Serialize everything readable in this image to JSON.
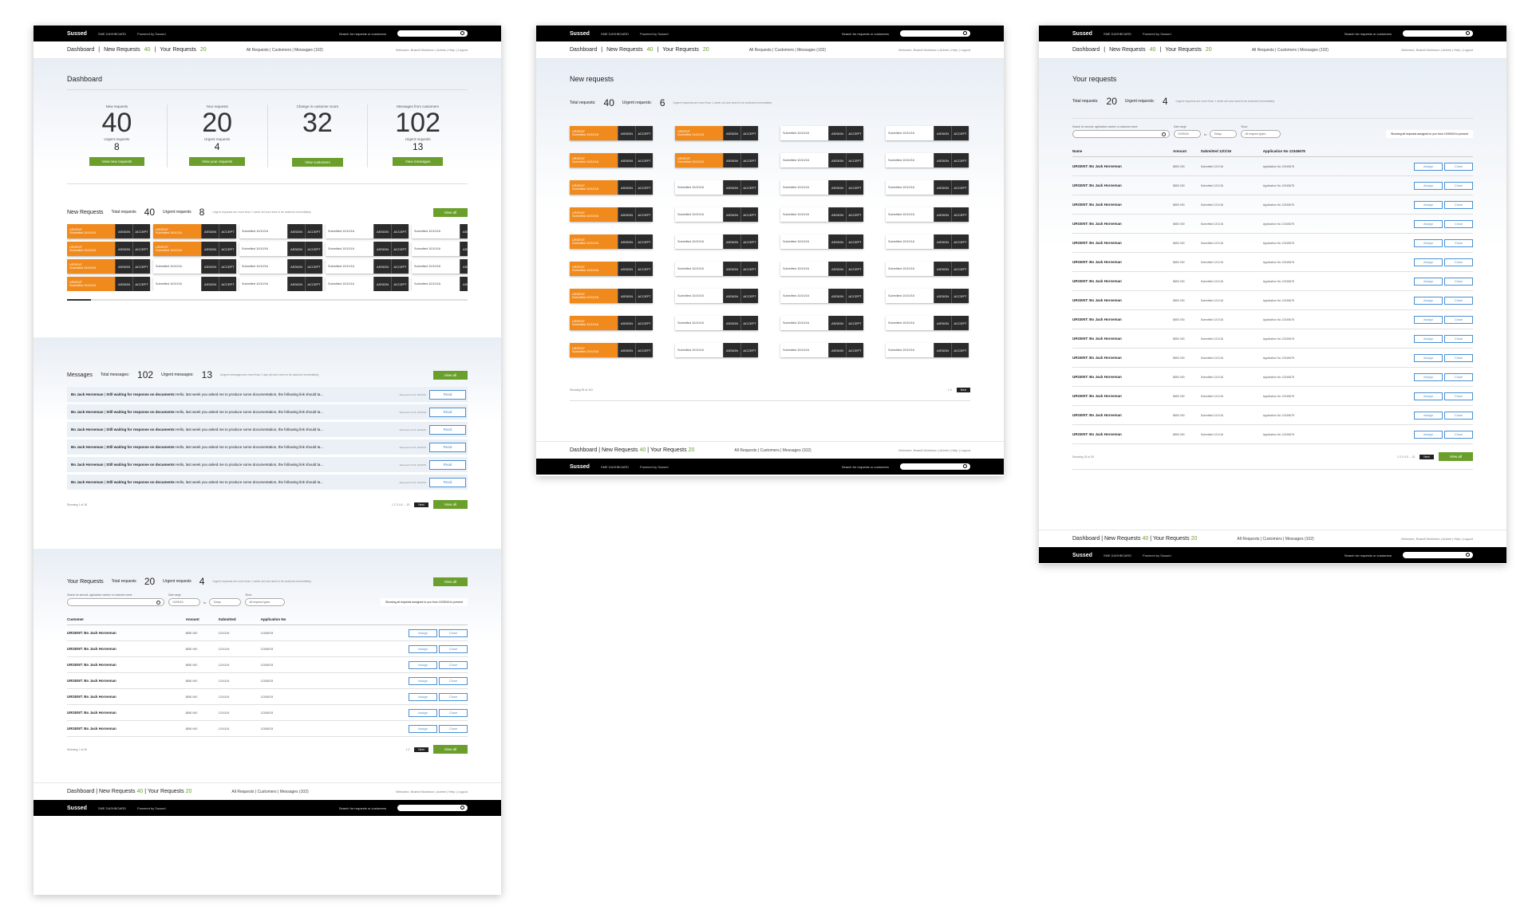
{
  "brand": "Sussed",
  "dashboard_label": "SME DASHBOARD",
  "powered": "Powered by Sussed",
  "search_label": "Search for requests or customers",
  "nav": {
    "dashboard": "Dashboard",
    "new_requests": "New Requests",
    "new_count": "40",
    "your_requests": "Your Requests",
    "your_count": "20",
    "mid": "All Requests | Customers | Messages (102)",
    "right": "Welcome, Brandi Mckinnon | Admin | Help | Logout"
  },
  "page1": {
    "title": "Dashboard",
    "stats": [
      {
        "label": "New requests",
        "big": "40",
        "sub_label": "Urgent requests",
        "sub": "8",
        "btn": "View new requests"
      },
      {
        "label": "Your requests",
        "big": "20",
        "sub_label": "Urgent requests",
        "sub": "4",
        "btn": "View your requests"
      },
      {
        "label": "Change in customer score",
        "big": "32",
        "sub_label": "",
        "sub": "",
        "btn": "View customers"
      },
      {
        "label": "Messages from customers",
        "big": "102",
        "sub_label": "Urgent requests",
        "sub": "13",
        "btn": "View messages"
      }
    ],
    "new_requests": {
      "title": "New Requests",
      "total_label": "Total requests",
      "total": "40",
      "urgent_label": "Urgent requests",
      "urgent": "8",
      "note": "Urgent requests are more than 1 week old and need to be actioned immediately",
      "view_all": "View all"
    },
    "cards": [
      {
        "urgent": true,
        "top": "URGENT",
        "sub": "Submitted 10/10/16"
      },
      {
        "urgent": true,
        "top": "URGENT",
        "sub": "Submitted 10/10/16"
      },
      {
        "urgent": false,
        "top": "",
        "sub": "Submitted 10/10/16"
      },
      {
        "urgent": false,
        "top": "",
        "sub": "Submitted 10/10/16"
      },
      {
        "urgent": false,
        "top": "",
        "sub": "Submitted 10/10/16"
      },
      {
        "urgent": true,
        "top": "URGENT",
        "sub": "Submitted 10/10/16"
      },
      {
        "urgent": true,
        "top": "URGENT",
        "sub": "Submitted 10/10/16"
      },
      {
        "urgent": false,
        "top": "",
        "sub": "Submitted 10/10/16"
      },
      {
        "urgent": false,
        "top": "",
        "sub": "Submitted 10/10/16"
      },
      {
        "urgent": false,
        "top": "",
        "sub": "Submitted 10/10/16"
      },
      {
        "urgent": true,
        "top": "URGENT",
        "sub": "Submitted 10/10/16"
      },
      {
        "urgent": false,
        "top": "",
        "sub": "Submitted 10/10/16"
      },
      {
        "urgent": false,
        "top": "",
        "sub": "Submitted 10/10/16"
      },
      {
        "urgent": false,
        "top": "",
        "sub": "Submitted 10/10/16"
      },
      {
        "urgent": false,
        "top": "",
        "sub": "Submitted 10/10/16"
      },
      {
        "urgent": true,
        "top": "URGENT",
        "sub": "Submitted 10/10/16"
      },
      {
        "urgent": false,
        "top": "",
        "sub": "Submitted 10/10/16"
      },
      {
        "urgent": false,
        "top": "",
        "sub": "Submitted 10/10/16"
      },
      {
        "urgent": false,
        "top": "",
        "sub": "Submitted 10/10/16"
      },
      {
        "urgent": false,
        "top": "",
        "sub": "Submitted 10/10/16"
      }
    ],
    "assign": "ASSIGN",
    "accept": "ACCEPT",
    "messages": {
      "title": "Messages",
      "total_label": "Total messages:",
      "total": "102",
      "urgent_label": "Urgent messages:",
      "urgent": "13",
      "note": "Urgent messages are more than 1 day old and need to be actioned immediately",
      "view_all": "View all"
    },
    "message_rows": [
      {
        "from": "Bo Jack Horseman",
        "subject": "Still waiting for response on documents",
        "body": "Hello, last week you asked me to produce some documentation, the following link should ta...",
        "time": "Received 12:31 10/10/16"
      },
      {
        "from": "Bo Jack Horseman",
        "subject": "Still waiting for response on documents",
        "body": "Hello, last week you asked me to produce some documentation, the following link should ta...",
        "time": "Received 12:31 10/10/16"
      },
      {
        "from": "Bo Jack Horseman",
        "subject": "Still waiting for response on documents",
        "body": "Hello, last week you asked me to produce some documentation, the following link should ta...",
        "time": "Received 12:31 10/10/16"
      },
      {
        "from": "Bo Jack Horseman",
        "subject": "Still waiting for response on documents",
        "body": "Hello, last week you asked me to produce some documentation, the following link should ta...",
        "time": "Received 12:31 10/10/16"
      },
      {
        "from": "Bo Jack Horseman",
        "subject": "Still waiting for response on documents",
        "body": "Hello, last week you asked me to produce some documentation, the following link should ta...",
        "time": "Received 12:31 10/10/16"
      },
      {
        "from": "Bo Jack Horseman",
        "subject": "Still waiting for response on documents",
        "body": "Hello, last week you asked me to produce some documentation, the following link should ta...",
        "time": "Received 12:31 10/10/16"
      }
    ],
    "read_label": "Read",
    "showing_messages": "Showing 1 of 18",
    "pages": "1 2 3 4 5 ... 10",
    "next": "Next",
    "your_requests": {
      "title": "Your Requests",
      "total_label": "Total requests",
      "total": "20",
      "urgent_label": "Urgent requests",
      "urgent": "4",
      "note": "Urgent requests are more than 1 week old and need to be actioned immediately",
      "view_all": "View all"
    },
    "filters": {
      "search_label": "Search for amount, application number or customer name",
      "date_label": "Date range",
      "from": "10/09/16",
      "to_label": "to",
      "to": "Today",
      "show_label": "Show",
      "show_value": "All request types",
      "note": "Showing all requests assigned to you from 10/09/16 to present"
    },
    "table_headers": [
      "Customer",
      "Amount",
      "Submitted",
      "Application No",
      ""
    ],
    "table_rows": [
      {
        "name": "URGENT: Bo Jack Horseman",
        "amount": "$850 000",
        "submitted": "12/10/16",
        "app": "12345678"
      },
      {
        "name": "URGENT: Bo Jack Horseman",
        "amount": "$850 000",
        "submitted": "12/10/16",
        "app": "12345678"
      },
      {
        "name": "URGENT: Bo Jack Horseman",
        "amount": "$850 000",
        "submitted": "12/10/16",
        "app": "12345678"
      },
      {
        "name": "URGENT: Bo Jack Horseman",
        "amount": "$850 000",
        "submitted": "12/10/16",
        "app": "12345678"
      },
      {
        "name": "URGENT: Bo Jack Horseman",
        "amount": "$850 000",
        "submitted": "12/10/16",
        "app": "12345678"
      },
      {
        "name": "URGENT: Bo Jack Horseman",
        "amount": "$850 000",
        "submitted": "12/10/16",
        "app": "12345678"
      },
      {
        "name": "URGENT: Bo Jack Horseman",
        "amount": "$850 000",
        "submitted": "12/10/16",
        "app": "12345678"
      }
    ],
    "assign_btn": "Assign",
    "close_btn": "Close",
    "showing_table": "Showing 7 of 20",
    "table_pages": "1 2"
  },
  "page2": {
    "title": "New requests",
    "total_label": "Total requests:",
    "total": "40",
    "urgent_label": "Urgent requests:",
    "urgent": "6",
    "note": "Urgent requests are more than 1 week old and need to be actioned immediately",
    "grid": [
      true,
      true,
      false,
      false,
      true,
      true,
      false,
      false,
      true,
      false,
      false,
      false,
      true,
      false,
      false,
      false,
      true,
      false,
      false,
      false,
      true,
      false,
      false,
      false,
      true,
      false,
      false,
      false,
      true,
      false,
      false,
      false,
      true,
      false,
      false,
      false
    ],
    "urgent_text": "URGENT",
    "submitted_text": "Submitted 10/10/16",
    "showing": "Showing 36 of 110",
    "pages": "1 2",
    "next": "Next"
  },
  "page3": {
    "title": "Your requests",
    "total_label": "Total requests:",
    "total": "20",
    "urgent_label": "Urgent requests:",
    "urgent": "4",
    "note": "Urgent requests are more than 1 week old and need to be actioned immediately",
    "filters": {
      "search_label": "Search for amount, application number or customer name",
      "date_label": "Date range",
      "from": "10/09/16",
      "to_label": "to",
      "to": "Today",
      "show_label": "Show",
      "show_value": "All request types",
      "note": "Showing all requests assigned to you from 10/09/16 to present"
    },
    "headers": [
      "Name",
      "Amount",
      "Submitted 12/1/16",
      "Application No 12345678"
    ],
    "rows_count_label": "Showing 15 of 20",
    "row": {
      "name": "URGENT: Bo Jack Horseman",
      "amount": "$850 000",
      "submitted": "Submitted 12/1/16",
      "app": "Application No 12345678"
    },
    "pages": "1 2 3 4 5 ... 10",
    "next": "Next",
    "view_all": "View all"
  }
}
